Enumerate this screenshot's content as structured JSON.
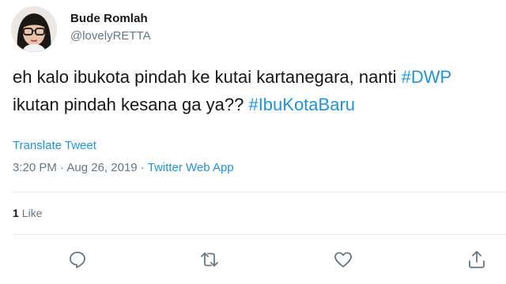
{
  "user": {
    "display_name": "Bude Romlah",
    "handle": "@lovelyRETTA"
  },
  "tweet": {
    "text_1": "eh kalo ibukota pindah ke kutai kartanegara, nanti ",
    "hashtag_1": "#DWP",
    "text_2": " ikutan pindah kesana ga ya?? ",
    "hashtag_2": "#IbuKotaBaru"
  },
  "translate_label": "Translate Tweet",
  "meta": {
    "time": "3:20 PM",
    "separator_1": " · ",
    "date": "Aug 26, 2019",
    "separator_2": " · ",
    "source": "Twitter Web App"
  },
  "engagement": {
    "likes_count": "1",
    "likes_label": "Like"
  },
  "actions": {
    "reply_icon": "reply-icon",
    "retweet_icon": "retweet-icon",
    "like_icon": "heart-icon",
    "share_icon": "share-icon"
  },
  "colors": {
    "link": "#1b95e0",
    "secondary_text": "#657786",
    "divider": "#e6ecf0"
  }
}
